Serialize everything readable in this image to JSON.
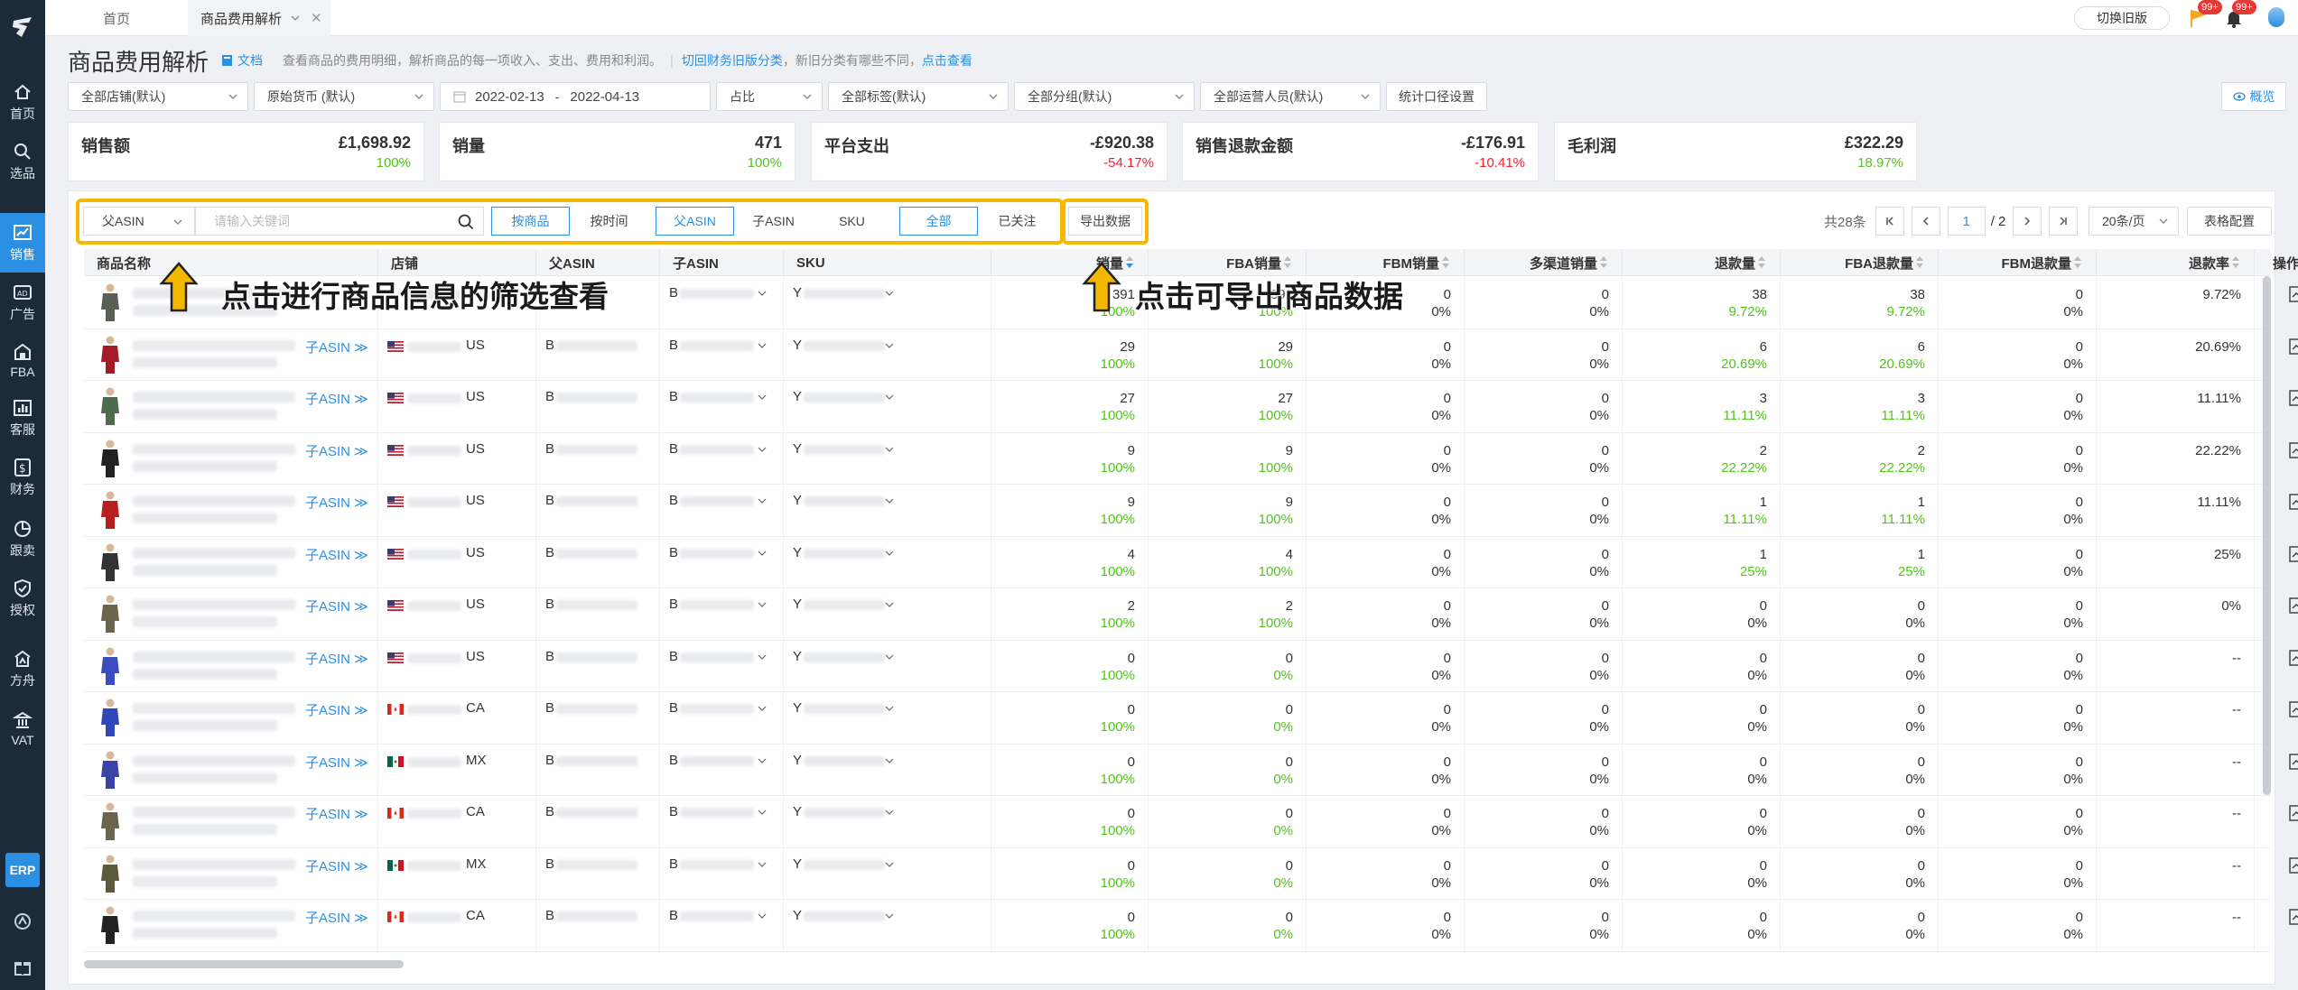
{
  "sidebar": {
    "items": [
      {
        "label": "首页",
        "icon": "home-icon"
      },
      {
        "label": "选品",
        "icon": "search-icon"
      },
      {
        "label": "销售",
        "icon": "chart-line-icon",
        "active": true
      },
      {
        "label": "广告",
        "icon": "ad-icon"
      },
      {
        "label": "FBA",
        "icon": "warehouse-icon"
      },
      {
        "label": "客服",
        "icon": "chart-bar-icon"
      },
      {
        "label": "财务",
        "icon": "dollar-icon"
      },
      {
        "label": "跟卖",
        "icon": "pie-icon"
      },
      {
        "label": "授权",
        "icon": "shield-icon"
      },
      {
        "label": "方舟",
        "icon": "ark-icon"
      },
      {
        "label": "VAT",
        "icon": "bank-icon"
      }
    ],
    "erp": "ERP"
  },
  "topbar": {
    "tab_home": "首页",
    "tab_current": "商品费用解析",
    "old_version": "切换旧版",
    "badge1": "99+",
    "badge2": "99+"
  },
  "header": {
    "title": "商品费用解析",
    "doc": "文档",
    "desc": "查看商品的费用明细，解析商品的每一项收入、支出、费用和利润。",
    "link1": "切回财务旧版分类",
    "desc2": "，新旧分类有哪些不同，",
    "link2": "点击查看"
  },
  "filters": {
    "store": "全部店铺(默认)",
    "currency": "原始货币 (默认)",
    "date_start": "2022-02-13",
    "date_sep": "-",
    "date_end": "2022-04-13",
    "ratio": "占比",
    "tags": "全部标签(默认)",
    "group": "全部分组(默认)",
    "ops": "全部运营人员(默认)",
    "calib": "统计口径设置",
    "overview": "概览"
  },
  "cards": [
    {
      "label": "销售额",
      "value": "£1,698.92",
      "pct": "100%",
      "color": "g"
    },
    {
      "label": "销量",
      "value": "471",
      "pct": "100%",
      "color": "g"
    },
    {
      "label": "平台支出",
      "value": "-£920.38",
      "pct": "-54.17%",
      "color": "r"
    },
    {
      "label": "销售退款金额",
      "value": "-£176.91",
      "pct": "-10.41%",
      "color": "r"
    },
    {
      "label": "毛利润",
      "value": "£322.29",
      "pct": "18.97%",
      "color": "g"
    }
  ],
  "toolbar": {
    "asin_type": "父ASIN",
    "search_placeholder": "请输入关键词",
    "by_product": "按商品",
    "by_time": "按时间",
    "parent_asin": "父ASIN",
    "child_asin": "子ASIN",
    "sku": "SKU",
    "all": "全部",
    "followed": "已关注",
    "export": "导出数据",
    "total": "共28条",
    "page_cur": "1",
    "page_total": "/ 2",
    "page_size": "20条/页",
    "table_config": "表格配置"
  },
  "annotations": {
    "left": "点击进行商品信息的筛选查看",
    "right": "点击可导出商品数据"
  },
  "table": {
    "headers": [
      "商品名称",
      "店铺",
      "父ASIN",
      "子ASIN",
      "SKU",
      "销量",
      "FBA销量",
      "FBM销量",
      "多渠道销量",
      "退款量",
      "FBA退款量",
      "FBM退款量",
      "退款率",
      "操作"
    ],
    "sub_asin_label": "子ASIN",
    "rows": [
      {
        "market": "",
        "flag": "",
        "parent": "",
        "child": "B",
        "sku": "Y",
        "v": [
          "391",
          "100%",
          "38",
          "9.72%",
          "38",
          "9.72%",
          "9.72%"
        ],
        "fba": [
          "391",
          "100%"
        ],
        "thumb": "#5a5f55"
      },
      {
        "market": "US",
        "flag": "us",
        "parent": "B",
        "child": "B",
        "sku": "Y",
        "v": [
          "29",
          "100%",
          "6",
          "20.69%",
          "6",
          "20.69%",
          "20.69%"
        ],
        "fba": [
          "29",
          "100%"
        ],
        "thumb": "#a11c26"
      },
      {
        "market": "US",
        "flag": "us",
        "parent": "B",
        "child": "B",
        "sku": "Y",
        "v": [
          "27",
          "100%",
          "3",
          "11.11%",
          "3",
          "11.11%",
          "11.11%"
        ],
        "fba": [
          "27",
          "100%"
        ],
        "thumb": "#4e6b4e"
      },
      {
        "market": "US",
        "flag": "us",
        "parent": "B",
        "child": "B",
        "sku": "Y",
        "v": [
          "9",
          "100%",
          "2",
          "22.22%",
          "2",
          "22.22%",
          "22.22%"
        ],
        "fba": [
          "9",
          "100%"
        ],
        "thumb": "#222"
      },
      {
        "market": "US",
        "flag": "us",
        "parent": "B",
        "child": "B",
        "sku": "Y",
        "v": [
          "9",
          "100%",
          "1",
          "11.11%",
          "1",
          "11.11%",
          "11.11%"
        ],
        "fba": [
          "9",
          "100%"
        ],
        "thumb": "#b51f1f"
      },
      {
        "market": "US",
        "flag": "us",
        "parent": "B",
        "child": "B",
        "sku": "Y",
        "v": [
          "4",
          "100%",
          "1",
          "25%",
          "1",
          "25%",
          "25%"
        ],
        "fba": [
          "4",
          "100%"
        ],
        "thumb": "#333"
      },
      {
        "market": "US",
        "flag": "us",
        "parent": "B",
        "child": "B",
        "sku": "Y",
        "v": [
          "2",
          "100%",
          "0",
          "0%",
          "0",
          "0%",
          "0%"
        ],
        "fba": [
          "2",
          "100%"
        ],
        "thumb": "#6b6550"
      },
      {
        "market": "US",
        "flag": "us",
        "parent": "B",
        "child": "B",
        "sku": "Y",
        "v": [
          "0",
          "100%",
          "0",
          "0%",
          "0",
          "0%",
          "--"
        ],
        "fba": [
          "0",
          "0%"
        ],
        "thumb": "#3b4cc0"
      },
      {
        "market": "CA",
        "flag": "ca",
        "parent": "B",
        "child": "B",
        "sku": "Y",
        "v": [
          "0",
          "100%",
          "0",
          "0%",
          "0",
          "0%",
          "--"
        ],
        "fba": [
          "0",
          "0%"
        ],
        "thumb": "#3146b8"
      },
      {
        "market": "MX",
        "flag": "mx",
        "parent": "B",
        "child": "B",
        "sku": "Y",
        "v": [
          "0",
          "100%",
          "0",
          "0%",
          "0",
          "0%",
          "--"
        ],
        "fba": [
          "0",
          "0%"
        ],
        "thumb": "#3c43a8"
      },
      {
        "market": "CA",
        "flag": "ca",
        "parent": "B",
        "child": "B",
        "sku": "Y",
        "v": [
          "0",
          "100%",
          "0",
          "0%",
          "0",
          "0%",
          "--"
        ],
        "fba": [
          "0",
          "0%"
        ],
        "thumb": "#6b6550"
      },
      {
        "market": "MX",
        "flag": "mx",
        "parent": "B",
        "child": "B",
        "sku": "Y",
        "v": [
          "0",
          "100%",
          "0",
          "0%",
          "0",
          "0%",
          "--"
        ],
        "fba": [
          "0",
          "0%"
        ],
        "thumb": "#5c5a3a"
      },
      {
        "market": "CA",
        "flag": "ca",
        "parent": "B",
        "child": "B",
        "sku": "Y",
        "v": [
          "0",
          "100%",
          "0",
          "0%",
          "0",
          "0%",
          "--"
        ],
        "fba": [
          "0",
          "0%"
        ],
        "thumb": "#222"
      }
    ]
  },
  "colors": {
    "accent": "#2b8fe3",
    "highlight": "#f5b800",
    "positive": "#52c41a",
    "negative": "#f5222d"
  }
}
